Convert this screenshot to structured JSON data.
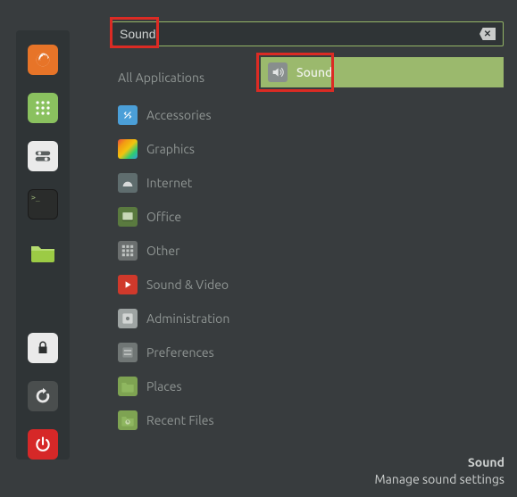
{
  "search": {
    "value": "Sound"
  },
  "categories": {
    "all": "All Applications",
    "items": [
      {
        "label": "Accessories"
      },
      {
        "label": "Graphics"
      },
      {
        "label": "Internet"
      },
      {
        "label": "Office"
      },
      {
        "label": "Other"
      },
      {
        "label": "Sound & Video"
      },
      {
        "label": "Administration"
      },
      {
        "label": "Preferences"
      },
      {
        "label": "Places"
      },
      {
        "label": "Recent Files"
      }
    ]
  },
  "results": [
    {
      "label": "Sound"
    }
  ],
  "description": {
    "title": "Sound",
    "subtitle": "Manage sound settings"
  },
  "launcher": {
    "items": [
      "firefox",
      "applications",
      "settings",
      "terminal",
      "files",
      "lock",
      "restart",
      "power"
    ]
  }
}
